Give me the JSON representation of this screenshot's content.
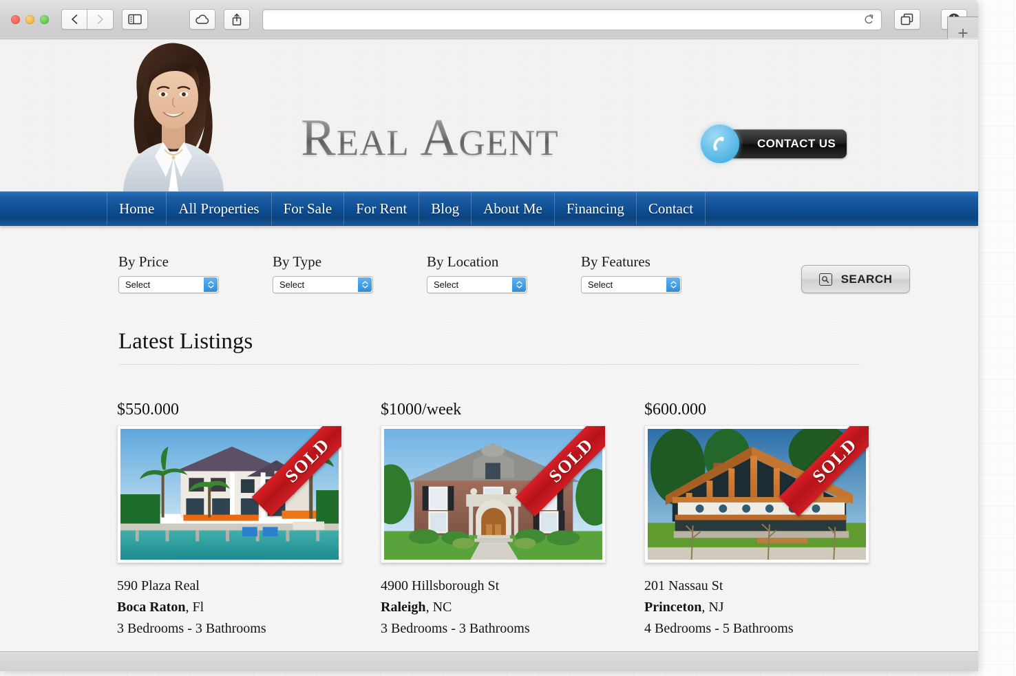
{
  "browser": {
    "traffic_lights": [
      "close",
      "minimize",
      "zoom"
    ],
    "back_label": "Back",
    "forward_label": "Forward",
    "sidebar_label": "Show Sidebar",
    "icloud_tabs_label": "iCloud Tabs",
    "share_label": "Share",
    "url_value": "",
    "url_placeholder": "",
    "reload_label": "Reload",
    "tab_overview_label": "Show All Tabs",
    "downloads_label": "Downloads",
    "new_tab_label": "+"
  },
  "site": {
    "title": "Real Agent",
    "contact_button": "CONTACT US"
  },
  "nav": {
    "items": [
      {
        "label": "Home"
      },
      {
        "label": "All Properties"
      },
      {
        "label": "For Sale"
      },
      {
        "label": "For Rent"
      },
      {
        "label": "Blog"
      },
      {
        "label": "About Me"
      },
      {
        "label": "Financing"
      },
      {
        "label": "Contact"
      }
    ]
  },
  "filters": {
    "items": [
      {
        "label": "By Price",
        "value": "Select"
      },
      {
        "label": "By Type",
        "value": "Select"
      },
      {
        "label": "By Location",
        "value": "Select"
      },
      {
        "label": "By Features",
        "value": "Select"
      }
    ],
    "search_button": "SEARCH"
  },
  "listings_section": {
    "title": "Latest Listings",
    "items": [
      {
        "price": "$550.000",
        "badge": "SOLD",
        "address": "590 Plaza Real",
        "city": "Boca Raton",
        "state": ", Fl",
        "rooms": "3 Bedrooms - 3 Bathrooms"
      },
      {
        "price": "$1000/week",
        "badge": "SOLD",
        "address": "4900 Hillsborough St",
        "city": "Raleigh",
        "state": ", NC",
        "rooms": "3 Bedrooms - 3 Bathrooms"
      },
      {
        "price": "$600.000",
        "badge": "SOLD",
        "address": "201 Nassau St",
        "city": "Princeton",
        "state": ", NJ",
        "rooms": "4 Bedrooms - 5 Bathrooms"
      }
    ]
  },
  "colors": {
    "nav_blue": "#0f4f94",
    "sold_red": "#c8181f",
    "stepper_blue": "#2d8ede",
    "phone_blue": "#5ab9e8"
  }
}
